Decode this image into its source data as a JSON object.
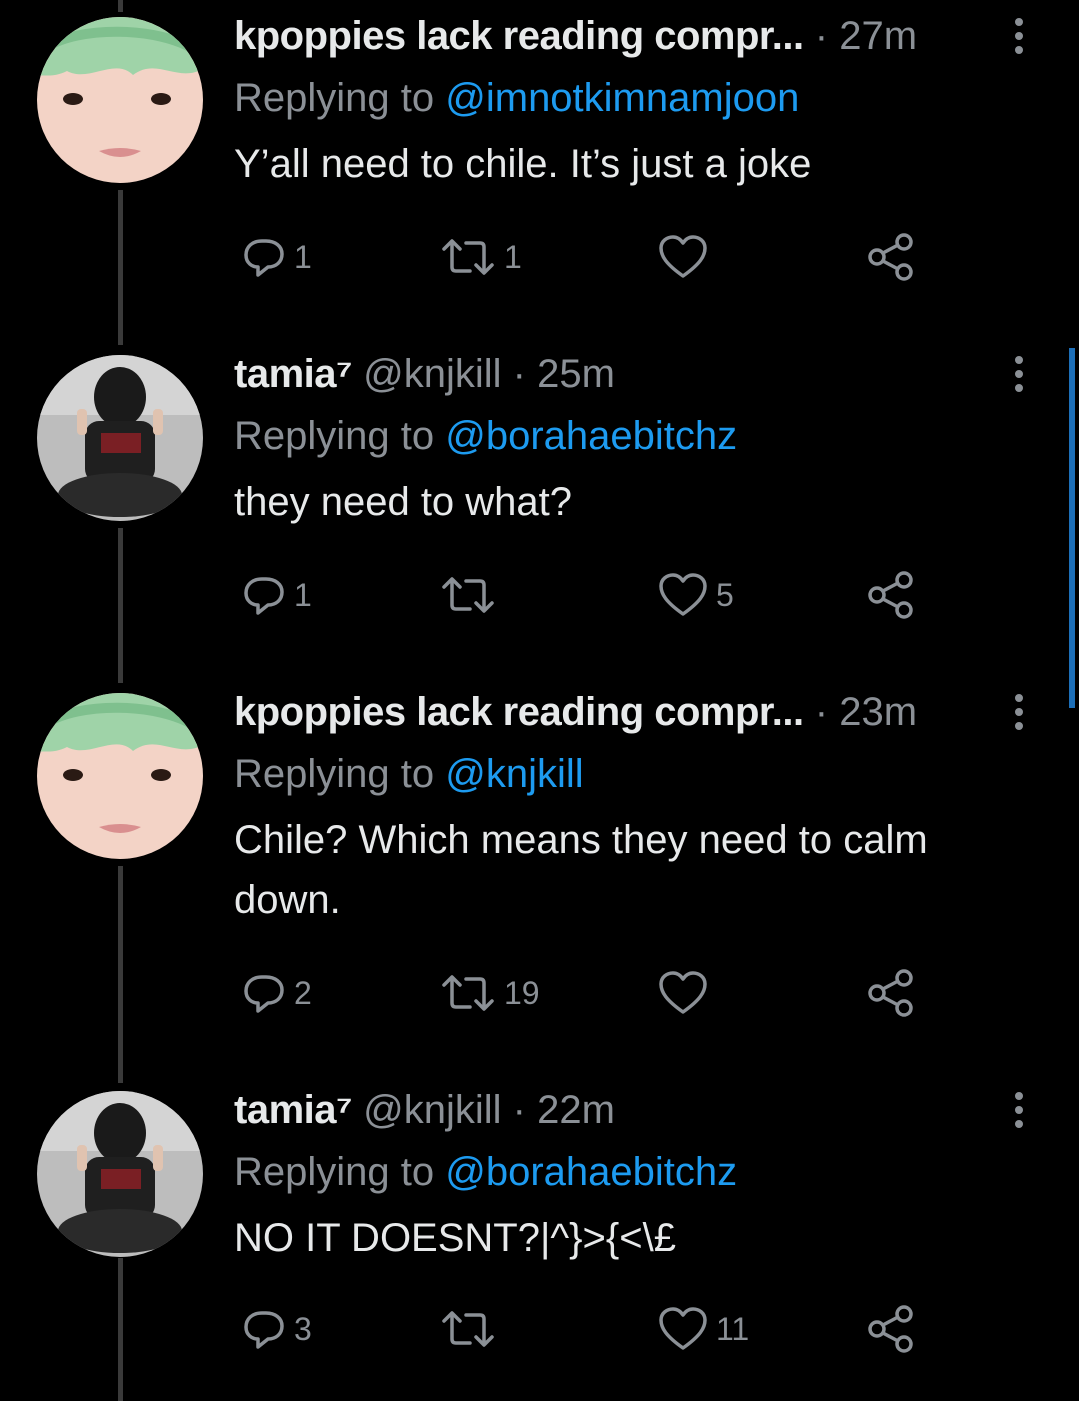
{
  "tweets": [
    {
      "name": "kpoppies lack reading compr...",
      "handle": "",
      "time": "27m",
      "replying_label": "Replying to",
      "replying_to": "@imnotkimnamjoon",
      "text": "Y’all need to chile. It’s just a joke",
      "replies": "1",
      "retweets": "1",
      "likes": "",
      "avatar": "green-hair-avatar"
    },
    {
      "name": "tamia⁷",
      "handle": "@knjkill",
      "time": "25m",
      "replying_label": "Replying to",
      "replying_to": "@borahaebitchz",
      "text": "they need to what?",
      "replies": "1",
      "retweets": "",
      "likes": "5",
      "avatar": "seated-person-avatar"
    },
    {
      "name": "kpoppies lack reading compr...",
      "handle": "",
      "time": "23m",
      "replying_label": "Replying to",
      "replying_to": "@knjkill",
      "text": "Chile? Which means they need to calm down.",
      "replies": "2",
      "retweets": "19",
      "likes": "",
      "avatar": "green-hair-avatar"
    },
    {
      "name": "tamia⁷",
      "handle": "@knjkill",
      "time": "22m",
      "replying_label": "Replying to",
      "replying_to": "@borahaebitchz",
      "text": "NO IT DOESNT?|^}>{<\\£",
      "replies": "3",
      "retweets": "",
      "likes": "11",
      "avatar": "seated-person-avatar"
    }
  ],
  "icons": {
    "reply": "reply-icon",
    "retweet": "retweet-icon",
    "like": "heart-icon",
    "share": "share-icon",
    "more": "more-options-icon"
  },
  "colors": {
    "background": "#000000",
    "text": "#e7e9ea",
    "muted": "#8b9096",
    "link": "#1d9bf0",
    "thread_line": "#3a3a3a",
    "scroll_indicator": "#1d6fb8"
  }
}
